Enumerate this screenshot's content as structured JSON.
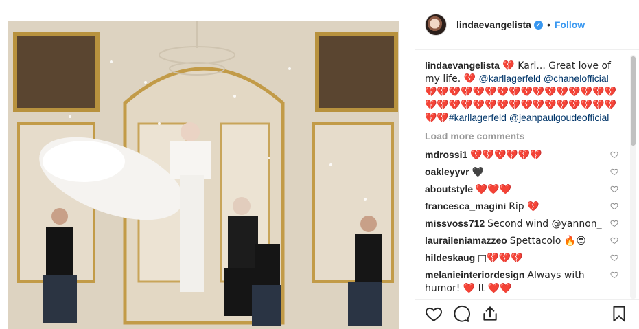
{
  "post": {
    "username": "linda​evangelista",
    "verified_glyph": "✔",
    "separator": "•",
    "follow_label": "Follow"
  },
  "caption": {
    "username": "lindaevangelista",
    "text_1": " 💔 Karl... Great love of my life. 💔 ",
    "mention_1": "@karllagerfeld",
    "mention_2": "@chanelofficial",
    "hearts": "💔💔💔💔💔💔💔💔💔💔💔💔💔💔💔💔💔💔💔💔💔💔💔💔💔💔💔💔💔💔💔💔💔💔",
    "hashtag": "#karllagerfeld",
    "mention_3": "@jeanpaulgoudeofficial"
  },
  "load_more_label": "Load more comments",
  "comments": [
    {
      "user": "mdrossi1",
      "text": "💔💔💔💔💔💔"
    },
    {
      "user": "oakleyyvr",
      "text": "🖤"
    },
    {
      "user": "aboutstyle",
      "text": "❤️❤️❤️"
    },
    {
      "user": "francesca_magini",
      "text": "Rip 💔"
    },
    {
      "user": "missvoss712",
      "text": "Second wind @yannon_"
    },
    {
      "user": "lauraileniamazzeo",
      "text": "Spettacolo 🔥😍"
    },
    {
      "user": "hildeskaug",
      "text": "□💔💔💔"
    },
    {
      "user": "melanieinteriordesign",
      "text": "Always with humor! ❤️ It ❤️❤️"
    }
  ],
  "icons": {
    "like": "heart-outline-icon",
    "comment": "comment-bubble-icon",
    "share": "share-icon",
    "save": "bookmark-icon",
    "comment_like": "heart-outline-icon"
  },
  "colors": {
    "follow_blue": "#3897f0",
    "link_blue": "#003569",
    "muted_gray": "#999999"
  }
}
